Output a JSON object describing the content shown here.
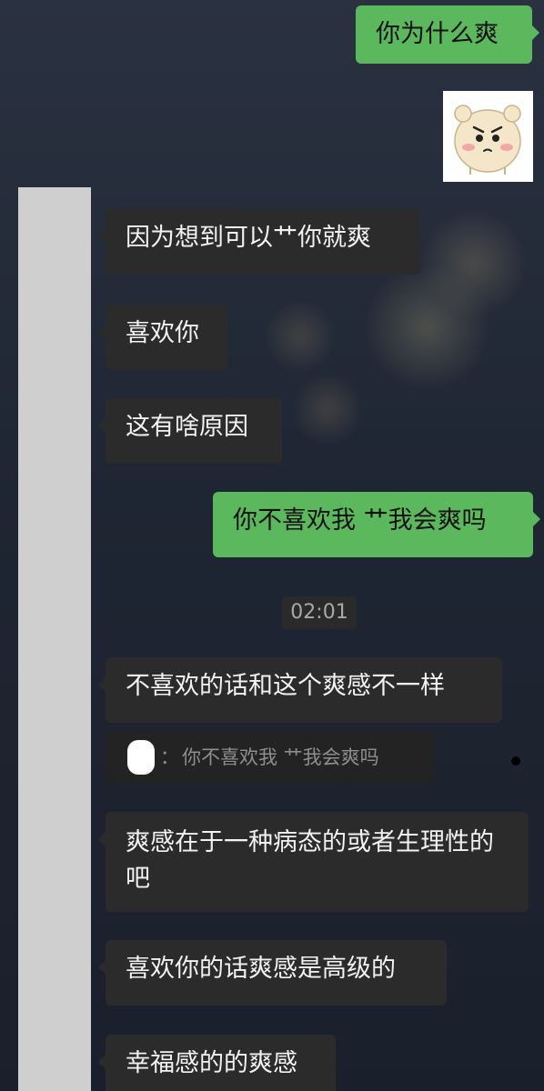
{
  "messages": {
    "m1": "你为什么爽",
    "m2": "因为想到可以艹你就爽",
    "m3": "喜欢你",
    "m4": "这有啥原因",
    "m5": "你不喜欢我 艹我会爽吗",
    "m6": "不喜欢的话和这个爽感不一样",
    "m7": "爽感在于一种病态的或者生理性的吧",
    "m8": "喜欢你的话爽感是高级的",
    "m9": "幸福感的的爽感"
  },
  "timestamp": "02:01",
  "quote": {
    "separator": "：",
    "text": "你不喜欢我 艹我会爽吗"
  },
  "sticker": {
    "name": "angry-bear-sticker"
  },
  "colors": {
    "sent_bubble": "#5cb85c",
    "received_bubble": "#2b2b2b",
    "background": "#1d2430"
  }
}
